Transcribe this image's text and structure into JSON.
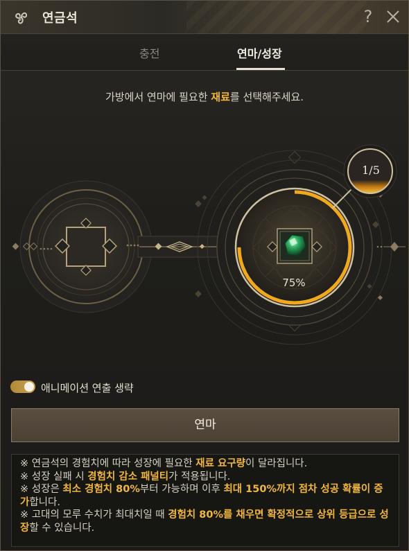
{
  "window": {
    "title": "연금석",
    "help_label": "?"
  },
  "tabs": [
    {
      "label": "충전",
      "active": false
    },
    {
      "label": "연마/성장",
      "active": true
    }
  ],
  "instruction": {
    "part1": "가방에서 연마에 필요한 ",
    "highlight": "재료",
    "part2": "를 선택해주세요."
  },
  "enhance": {
    "progress_percent": 75,
    "progress_label": "75%",
    "stage_label": "1/5"
  },
  "animation_skip": {
    "label": "애니메이션 연출 생략",
    "enabled": true
  },
  "action_button": {
    "label": "연마"
  },
  "notes": [
    [
      {
        "t": "※ 연금석의 경험치에 따라 성장에 필요한 "
      },
      {
        "t": "재료 요구량",
        "hl": true
      },
      {
        "t": "이 달라집니다."
      }
    ],
    [
      {
        "t": "※ 성장 실패 시 "
      },
      {
        "t": "경험치 감소 패널티",
        "hl": true
      },
      {
        "t": "가 적용됩니다."
      }
    ],
    [
      {
        "t": "※ 성장은 "
      },
      {
        "t": "최소 경험치 80%",
        "hl": true
      },
      {
        "t": "부터 가능하며 이후 "
      },
      {
        "t": "최대 150%까지 점차 성공 확률이 증가",
        "hl": true
      },
      {
        "t": "합니다."
      }
    ],
    [
      {
        "t": "※ 고대의 모루 수치가 최대치일 때 "
      },
      {
        "t": "경험치 80%를 채우면 확정적으로 상위 등급으로 성장",
        "hl": true
      },
      {
        "t": "할 수 있습니다."
      }
    ]
  ],
  "colors": {
    "accent": "#f1b640",
    "progress_ring": "#f0a91d",
    "gem": "#2fae62"
  },
  "icons": {
    "title": "triskelion-icon",
    "help": "question-mark-icon",
    "close": "close-icon",
    "material_slot": "empty-slot-icon",
    "result_item": "green-gem-icon"
  }
}
